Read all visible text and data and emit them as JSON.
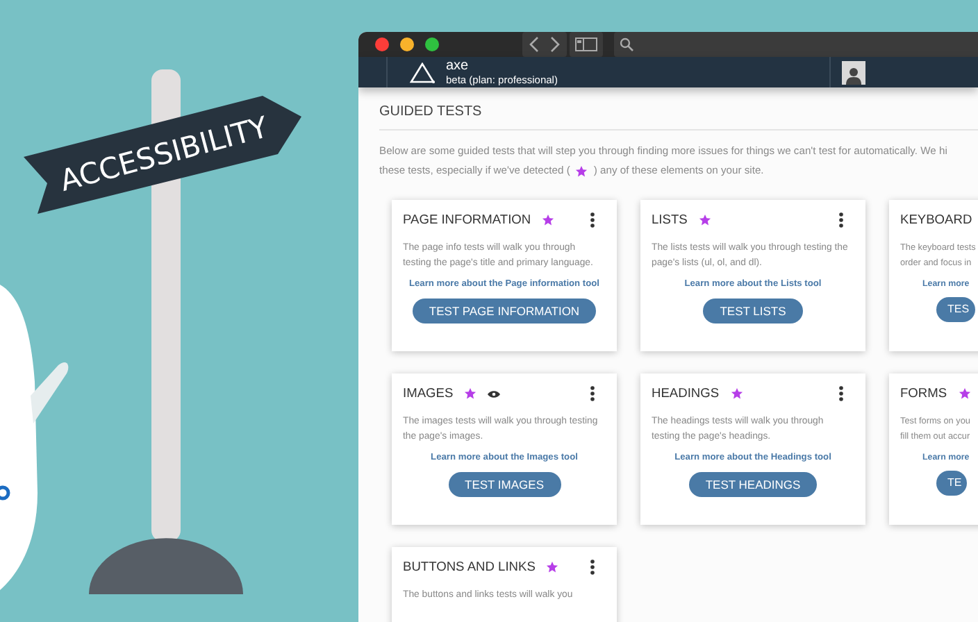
{
  "illustration": {
    "sign_text": "ACCESSIBILITY"
  },
  "app_header": {
    "name": "axe",
    "plan": "beta (plan: professional)"
  },
  "section_title": "GUIDED TESTS",
  "intro": {
    "line_1": "Below are some guided tests that will step you through finding more issues for things we can't test for automatically. We hi",
    "line_2_before": "these tests, especially if we've detected (",
    "line_2_after": ") any of these elements on your site."
  },
  "cards": [
    {
      "title": "PAGE INFORMATION",
      "starred": true,
      "description_lines": [
        "The page info tests will walk you through",
        "testing the page's title and primary language."
      ],
      "link": "Learn more about the Page information tool",
      "button": "TEST PAGE INFORMATION"
    },
    {
      "title": "LISTS",
      "starred": true,
      "description_lines": [
        "The lists tests will walk you through testing the",
        "page's lists (ul, ol, and dl)."
      ],
      "link": "Learn more about the Lists tool",
      "button": "TEST LISTS"
    },
    {
      "title": "KEYBOARD",
      "description_lines": [
        "The keyboard tests",
        "order and focus in"
      ],
      "link": "Learn more",
      "button": "TES"
    },
    {
      "title": "IMAGES",
      "starred": true,
      "eye": true,
      "description_lines": [
        "The images tests will walk you through testing",
        "the page's images."
      ],
      "link": "Learn more about the Images tool",
      "button": "TEST IMAGES"
    },
    {
      "title": "HEADINGS",
      "starred": true,
      "description_lines": [
        "The headings tests will walk you through",
        "testing the page's headings."
      ],
      "link": "Learn more about the Headings tool",
      "button": "TEST HEADINGS"
    },
    {
      "title": "FORMS",
      "starred": true,
      "description_lines": [
        "Test forms on you",
        "fill them out accur"
      ],
      "link": "Learn more",
      "button": "TE"
    },
    {
      "title": "BUTTONS AND LINKS",
      "starred": true,
      "description_lines": [
        "The buttons and links tests will walk you"
      ]
    }
  ]
}
